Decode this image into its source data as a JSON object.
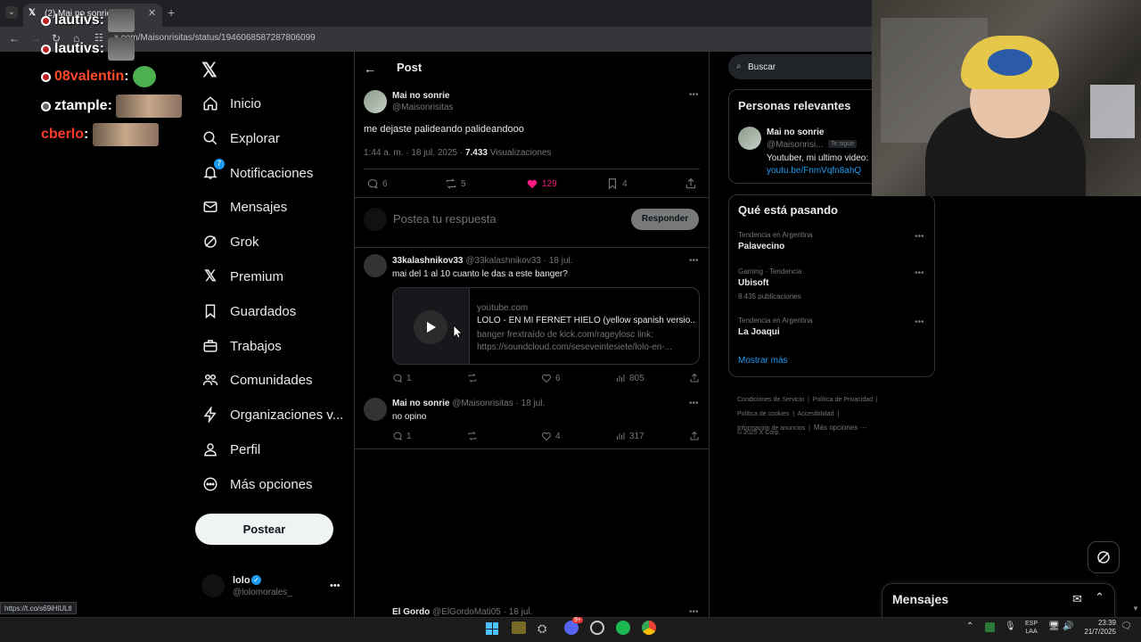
{
  "browser": {
    "tab_title": "(2) Mai no sonrie en X",
    "url": "x.com/Maisonrisitas/status/1946068587287806099",
    "status_url": "https://t.co/s69iHlULtl"
  },
  "chat": [
    {
      "user": "lautivs",
      "color": "#ffffff"
    },
    {
      "user": "lautivs",
      "color": "#ffffff"
    },
    {
      "user": "08valentin",
      "color": "#ff4a2a"
    },
    {
      "user": "ztample",
      "color": "#ffffff"
    },
    {
      "user": "cberlo",
      "color": "#ff3a2a"
    }
  ],
  "nav": {
    "items": [
      {
        "label": "Inicio",
        "icon": "home-icon"
      },
      {
        "label": "Explorar",
        "icon": "search-icon"
      },
      {
        "label": "Notificaciones",
        "icon": "bell-icon",
        "badge": "7"
      },
      {
        "label": "Mensajes",
        "icon": "mail-icon"
      },
      {
        "label": "Grok",
        "icon": "grok-icon"
      },
      {
        "label": "Premium",
        "icon": "x-icon"
      },
      {
        "label": "Guardados",
        "icon": "bookmark-icon"
      },
      {
        "label": "Trabajos",
        "icon": "briefcase-icon"
      },
      {
        "label": "Comunidades",
        "icon": "people-icon"
      },
      {
        "label": "Organizaciones v...",
        "icon": "bolt-icon"
      },
      {
        "label": "Perfil",
        "icon": "person-icon"
      },
      {
        "label": "Más opciones",
        "icon": "more-circle-icon"
      }
    ],
    "post_button": "Postear",
    "account": {
      "name": "lolo",
      "handle": "@lolomorales_"
    }
  },
  "main": {
    "header": "Post",
    "post": {
      "author": "Mai no sonrie",
      "handle": "@Maisonrisitas",
      "text": "me dejaste palideando palideandooo",
      "meta_time": "1:44 a. m. · 18 jul. 2025 ·",
      "views": "7.433",
      "views_label": "Visualizaciones",
      "replies": "6",
      "reposts": "5",
      "likes": "129",
      "bookmarks": "4"
    },
    "reply_box": {
      "placeholder": "Postea tu respuesta",
      "button": "Responder"
    },
    "replies": [
      {
        "author": "33kalashnikov33",
        "handle": "@33kalashnikov33 · 18 jul.",
        "text": "mai del 1 al 10 cuanto le das a este banger?",
        "card": {
          "domain": "youtube.com",
          "title": "LOLO - EN MI FERNET HIELO (yellow spanish versio...",
          "desc": "banger frextraído de kick.com/rageylosc link: https://soundcloud.com/seseveintesiete/lolo-en-..."
        },
        "replies": "1",
        "reposts": "",
        "likes": "6",
        "views": "805"
      },
      {
        "author": "Mai no sonrie",
        "handle": "@Maisonrisitas · 18 jul.",
        "text": "no opino",
        "replies": "1",
        "reposts": "",
        "likes": "4",
        "views": "317"
      },
      {
        "author": "El Gordo",
        "handle": "@ElGordoMati05 · 18 jul."
      }
    ]
  },
  "right": {
    "search_placeholder": "Buscar",
    "relevant": {
      "title": "Personas relevantes",
      "name": "Mai no sonrie",
      "handle": "@Maisonrisi...",
      "follows_badge": "Te sigue",
      "bio": "Youtuber, mi ultimo video:",
      "link": "youtu.be/FnmVqfn8ahQ"
    },
    "trends": {
      "title": "Qué está pasando",
      "items": [
        {
          "context": "Tendencia en Argentina",
          "name": "Palavecino",
          "count": ""
        },
        {
          "context": "Gaming · Tendencia",
          "name": "Ubisoft",
          "count": "8.435 publicaciones"
        },
        {
          "context": "Tendencia en Argentina",
          "name": "La Joaqui",
          "count": ""
        }
      ],
      "more": "Mostrar más"
    },
    "footer": {
      "links1": [
        "Condiciones de Servicio",
        "Política de Privacidad"
      ],
      "links2": [
        "Política de cookies",
        "Accesibilidad"
      ],
      "links3": [
        "Información de anuncios",
        "Más opciones ···"
      ],
      "copyright": "© 2025 X Corp."
    }
  },
  "messages_drawer": {
    "title": "Mensajes"
  },
  "taskbar": {
    "lang1": "ESP",
    "lang2": "LAA",
    "time": "23:39",
    "date": "21/7/2025",
    "discord_badge": "9+"
  },
  "colors": {
    "like": "#f91880",
    "link": "#1d9bf0",
    "accent_bg": "#000000"
  }
}
